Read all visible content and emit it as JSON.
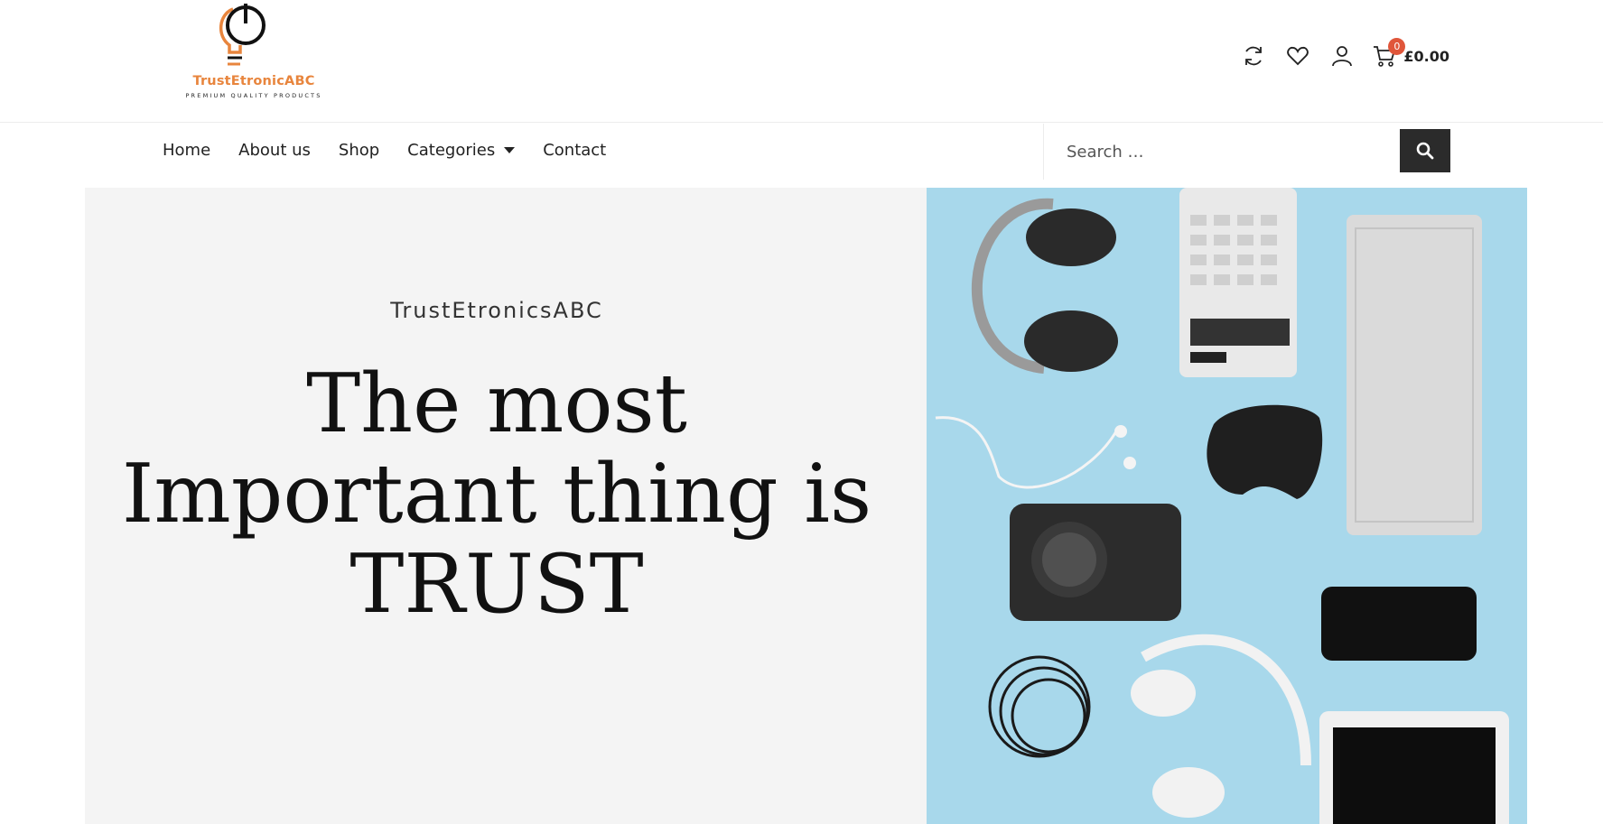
{
  "brand": {
    "name": "TrustEtronicABC",
    "tagline": "PREMIUM QUALITY PRODUCTS",
    "accent_color": "#e8853d"
  },
  "header": {
    "icons": [
      "refresh-icon",
      "heart-icon",
      "user-icon",
      "cart-icon"
    ],
    "cart": {
      "count": "0",
      "total": "£0.00",
      "badge_color": "#e0563a"
    }
  },
  "nav": {
    "items": [
      {
        "label": "Home"
      },
      {
        "label": "About us"
      },
      {
        "label": "Shop"
      },
      {
        "label": "Categories",
        "has_dropdown": true
      },
      {
        "label": "Contact"
      }
    ]
  },
  "search": {
    "placeholder": "Search …"
  },
  "hero": {
    "eyebrow": "TrustEtronicsABC",
    "headline": "The most Important thing is TRUST",
    "image_alt": "Electronics flat lay on a blue background: headphones, calculator, keyboard, earphones, game controller, camera, smartphone, cables, tablet",
    "image_background": "#a6d7ea"
  }
}
